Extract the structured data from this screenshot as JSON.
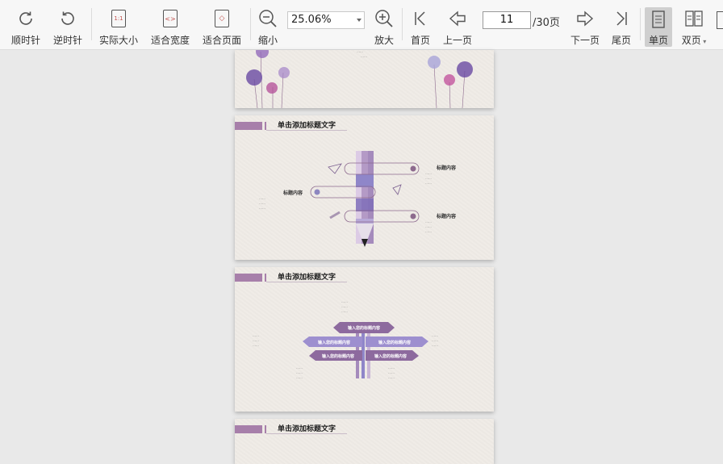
{
  "toolbar": {
    "rotate_cw": "顺时针",
    "rotate_ccw": "逆时针",
    "actual_size": "实际大小",
    "fit_width": "适合宽度",
    "fit_page": "适合页面",
    "zoom_out": "缩小",
    "zoom_value": "25.06%",
    "zoom_in": "放大",
    "first_page": "首页",
    "prev_page": "上一页",
    "current_page": "11",
    "total_pages": "/30页",
    "next_page": "下一页",
    "last_page": "尾页",
    "single_page": "单页",
    "double_page": "双页"
  },
  "icons": {
    "actual_size_glyph": "1:1",
    "fit_width_glyph": "<>",
    "fit_page_glyph": "◇"
  },
  "slides": [
    {
      "partial": true,
      "caption_lines": [
        "……",
        "……"
      ]
    },
    {
      "title": "单击添加标题文字",
      "items": [
        {
          "heading": "标题内容"
        },
        {
          "heading": "标题内容"
        },
        {
          "heading": "标题内容"
        }
      ]
    },
    {
      "title": "单击添加标题文字",
      "tags": [
        "输入您的标题内容",
        "输入您的标题内容",
        "输入您的标题内容",
        "输入您的标题内容",
        "输入您的标题内容"
      ]
    },
    {
      "title": "单击添加标题文字"
    }
  ],
  "colors": {
    "accent": "#a77faa",
    "toolbar_bg": "#f7f7f7",
    "workspace_bg": "#e9e9e9",
    "slide_bg": "#efebe6"
  }
}
